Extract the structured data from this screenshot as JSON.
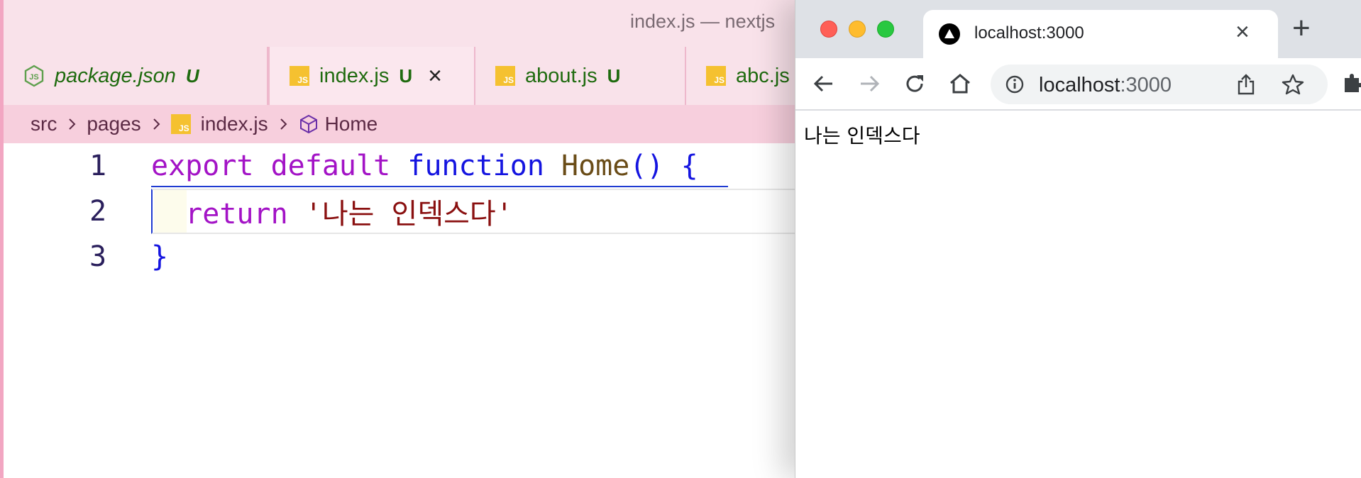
{
  "editor": {
    "window_title": "index.js — nextjs",
    "tabs": [
      {
        "name": "package.json",
        "status": "U",
        "icon": "nodejs-icon"
      },
      {
        "name": "index.js",
        "status": "U",
        "icon": "js-file-icon",
        "close": "×"
      },
      {
        "name": "about.js",
        "status": "U",
        "icon": "js-file-icon"
      },
      {
        "name": "abc.js",
        "status": "",
        "icon": "js-file-icon"
      }
    ],
    "breadcrumb": {
      "folder1": "src",
      "folder2": "pages",
      "file": "index.js",
      "symbol": "Home"
    },
    "code": {
      "line1": {
        "no": "1",
        "kw1": "export",
        "kw2": "default",
        "kw3": "function",
        "name": "Home",
        "parens": "()",
        "brace": "{"
      },
      "line2": {
        "no": "2",
        "kw": "return",
        "str": "'나는 인덱스다'"
      },
      "line3": {
        "no": "3",
        "brace": "}"
      }
    },
    "js_badge": "JS"
  },
  "browser": {
    "tab_title": "localhost:3000",
    "tab_close": "×",
    "new_tab": "+",
    "url_host": "localhost",
    "url_port": ":3000",
    "page_text": "나는 인덱스다"
  }
}
